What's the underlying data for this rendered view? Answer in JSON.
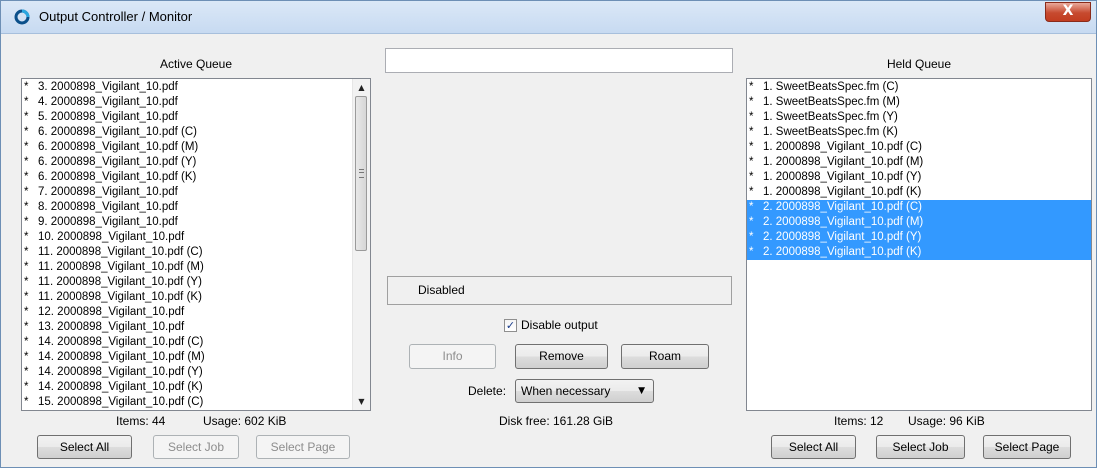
{
  "window": {
    "title": "Output Controller / Monitor",
    "close_label": "X"
  },
  "active_queue": {
    "label": "Active Queue",
    "items": [
      {
        "star": "*",
        "text": "3. 2000898_Vigilant_10.pdf"
      },
      {
        "star": "*",
        "text": "4. 2000898_Vigilant_10.pdf"
      },
      {
        "star": "*",
        "text": "5. 2000898_Vigilant_10.pdf"
      },
      {
        "star": "*",
        "text": "6. 2000898_Vigilant_10.pdf (C)"
      },
      {
        "star": "*",
        "text": "6. 2000898_Vigilant_10.pdf (M)"
      },
      {
        "star": "*",
        "text": "6. 2000898_Vigilant_10.pdf (Y)"
      },
      {
        "star": "*",
        "text": "6. 2000898_Vigilant_10.pdf (K)"
      },
      {
        "star": "*",
        "text": "7. 2000898_Vigilant_10.pdf"
      },
      {
        "star": "*",
        "text": "8. 2000898_Vigilant_10.pdf"
      },
      {
        "star": "*",
        "text": "9. 2000898_Vigilant_10.pdf"
      },
      {
        "star": "*",
        "text": "10. 2000898_Vigilant_10.pdf"
      },
      {
        "star": "*",
        "text": "11. 2000898_Vigilant_10.pdf (C)"
      },
      {
        "star": "*",
        "text": "11. 2000898_Vigilant_10.pdf (M)"
      },
      {
        "star": "*",
        "text": "11. 2000898_Vigilant_10.pdf (Y)"
      },
      {
        "star": "*",
        "text": "11. 2000898_Vigilant_10.pdf (K)"
      },
      {
        "star": "*",
        "text": "12. 2000898_Vigilant_10.pdf"
      },
      {
        "star": "*",
        "text": "13. 2000898_Vigilant_10.pdf"
      },
      {
        "star": "*",
        "text": "14. 2000898_Vigilant_10.pdf (C)"
      },
      {
        "star": "*",
        "text": "14. 2000898_Vigilant_10.pdf (M)"
      },
      {
        "star": "*",
        "text": "14. 2000898_Vigilant_10.pdf (Y)"
      },
      {
        "star": "*",
        "text": "14. 2000898_Vigilant_10.pdf (K)"
      },
      {
        "star": "*",
        "text": "15. 2000898_Vigilant_10.pdf (C)"
      }
    ],
    "items_count": "Items: 44",
    "usage": "Usage: 602 KiB",
    "buttons": {
      "select_all": "Select All",
      "select_job": "Select Job",
      "select_page": "Select Page"
    }
  },
  "center": {
    "status": "Disabled",
    "disable_output_label": "Disable output",
    "disable_output_checked": true,
    "check_mark": "✓",
    "buttons": {
      "info": "Info",
      "remove": "Remove",
      "roam": "Roam"
    },
    "delete_label": "Delete:",
    "delete_value": "When necessary",
    "disk_free": "Disk free: 161.28 GiB"
  },
  "held_queue": {
    "label": "Held Queue",
    "items": [
      {
        "star": "*",
        "text": "1. SweetBeatsSpec.fm (C)",
        "selected": false
      },
      {
        "star": "*",
        "text": "1. SweetBeatsSpec.fm (M)",
        "selected": false
      },
      {
        "star": "*",
        "text": "1. SweetBeatsSpec.fm (Y)",
        "selected": false
      },
      {
        "star": "*",
        "text": "1. SweetBeatsSpec.fm (K)",
        "selected": false
      },
      {
        "star": "*",
        "text": "1. 2000898_Vigilant_10.pdf (C)",
        "selected": false
      },
      {
        "star": "*",
        "text": "1. 2000898_Vigilant_10.pdf (M)",
        "selected": false
      },
      {
        "star": "*",
        "text": "1. 2000898_Vigilant_10.pdf (Y)",
        "selected": false
      },
      {
        "star": "*",
        "text": "1. 2000898_Vigilant_10.pdf (K)",
        "selected": false
      },
      {
        "star": "*",
        "text": "2. 2000898_Vigilant_10.pdf (C)",
        "selected": true
      },
      {
        "star": "*",
        "text": "2. 2000898_Vigilant_10.pdf (M)",
        "selected": true
      },
      {
        "star": "*",
        "text": "2. 2000898_Vigilant_10.pdf (Y)",
        "selected": true
      },
      {
        "star": "*",
        "text": "2. 2000898_Vigilant_10.pdf (K)",
        "selected": true
      }
    ],
    "items_count": "Items: 12",
    "usage": "Usage: 96 KiB",
    "buttons": {
      "select_all": "Select All",
      "select_job": "Select Job",
      "select_page": "Select Page"
    }
  },
  "icons": {
    "app": "app-logo-icon",
    "scroll_up": "▲",
    "scroll_down": "▼",
    "dropdown": "▼"
  },
  "colors": {
    "selection": "#3399ff",
    "close_button": "#c74a2f"
  }
}
